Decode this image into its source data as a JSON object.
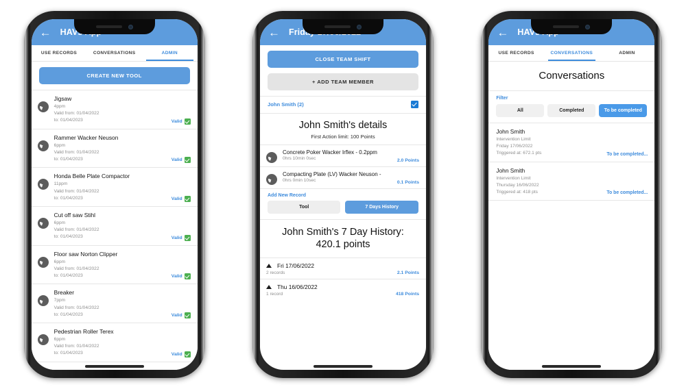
{
  "theme": {
    "header_blue": "#5d9cdd",
    "link_blue": "#3d8bdc",
    "valid_green": "#4caf50",
    "muted_grey": "#8d8d8d"
  },
  "phone_admin": {
    "appbar": {
      "back_icon": "back-arrow-icon",
      "title": "HAVs App"
    },
    "tabs": [
      {
        "label": "USE RECORDS",
        "active": false
      },
      {
        "label": "CONVERSATIONS",
        "active": false
      },
      {
        "label": "ADMIN",
        "active": true
      }
    ],
    "create_button": "CREATE NEW TOOL",
    "tools": [
      {
        "name": "Jigsaw",
        "ppm": "4ppm",
        "valid_from": "Valid from: 01/04/2022",
        "valid_to": "to: 01/04/2023",
        "status": "Valid"
      },
      {
        "name": "Rammer Wacker Neuson",
        "ppm": "6ppm",
        "valid_from": "Valid from: 01/04/2022",
        "valid_to": "to: 01/04/2023",
        "status": "Valid"
      },
      {
        "name": "Honda Belle Plate Compactor",
        "ppm": "11ppm",
        "valid_from": "Valid from: 01/04/2022",
        "valid_to": "to: 01/04/2023",
        "status": "Valid"
      },
      {
        "name": "Cut off saw Stihl",
        "ppm": "6ppm",
        "valid_from": "Valid from: 01/04/2022",
        "valid_to": "to: 01/04/2023",
        "status": "Valid"
      },
      {
        "name": "Floor saw Norton Clipper",
        "ppm": "6ppm",
        "valid_from": "Valid from: 01/04/2022",
        "valid_to": "to: 01/04/2023",
        "status": "Valid"
      },
      {
        "name": "Breaker",
        "ppm": "7ppm",
        "valid_from": "Valid from: 01/04/2022",
        "valid_to": "to: 01/04/2023",
        "status": "Valid"
      },
      {
        "name": "Pedestrian Roller Terex",
        "ppm": "6ppm",
        "valid_from": "Valid from: 01/04/2022",
        "valid_to": "to: 01/04/2023",
        "status": "Valid"
      }
    ]
  },
  "phone_shift": {
    "appbar": {
      "back_icon": "back-arrow-icon",
      "title": "Friday 17/06/2022"
    },
    "close_shift_button": "CLOSE TEAM SHIFT",
    "add_member_button": "+ ADD TEAM MEMBER",
    "member": {
      "name": "John Smith (2)",
      "checked": true
    },
    "details": {
      "title": "John Smith's details",
      "limit": "First Action limit: 100 Points",
      "records": [
        {
          "name": "Concrete Poker Wacker Irflex - 0.2ppm",
          "duration": "0hrs 10min 0sec",
          "points": "2.0 Points"
        },
        {
          "name": "Compacting Plate (LV) Wacker Neuson -",
          "duration": "0hrs 0min 10sec",
          "points": "0.1 Points"
        }
      ],
      "add_record_link": "Add New Record"
    },
    "segmented": [
      {
        "label": "Tool",
        "active": false
      },
      {
        "label": "7 Days History",
        "active": true
      }
    ],
    "history": {
      "title_line1": "John Smith's 7 Day History:",
      "title_line2": "420.1 points",
      "rows": [
        {
          "date": "Fri 17/06/2022",
          "records": "2 records",
          "points": "2.1 Points"
        },
        {
          "date": "Thu 16/06/2022",
          "records": "1 record",
          "points": "418 Points"
        }
      ]
    }
  },
  "phone_conversations": {
    "appbar": {
      "back_icon": "back-arrow-icon",
      "title": "HAVs App"
    },
    "tabs": [
      {
        "label": "USE RECORDS",
        "active": false
      },
      {
        "label": "CONVERSATIONS",
        "active": true
      },
      {
        "label": "ADMIN",
        "active": false
      }
    ],
    "page_title": "Conversations",
    "filter_label": "Filter",
    "filters": [
      {
        "label": "All",
        "active": false
      },
      {
        "label": "Completed",
        "active": false
      },
      {
        "label": "To be completed",
        "active": true
      }
    ],
    "conversations": [
      {
        "name": "John Smith",
        "reason": "Intervention Limit",
        "date": "Friday 17/06/2022",
        "triggered": "Triggered at: 672.1 pts",
        "status": "To be completed..."
      },
      {
        "name": "John Smith",
        "reason": "Intervention Limit",
        "date": "Thursday 16/06/2022",
        "triggered": "Triggered at: 418 pts",
        "status": "To be completed..."
      }
    ]
  }
}
